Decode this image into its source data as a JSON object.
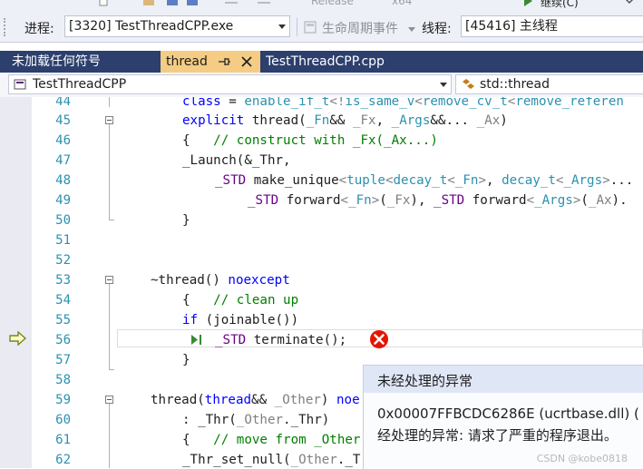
{
  "toolbar": {
    "configuration": "Release",
    "platform": "x64",
    "continue_label": "继续(C)"
  },
  "debug_location": {
    "process_label": "进程:",
    "process_value": "[3320] TestThreadCPP.exe",
    "lifecycle_label": "生命周期事件",
    "thread_label": "线程:",
    "thread_value": "[45416] 主线程"
  },
  "tabs": [
    {
      "label": "未加载任何符号"
    },
    {
      "label": "thread",
      "active": true
    },
    {
      "label": "TestThreadCPP.cpp"
    }
  ],
  "navbar": {
    "project": "TestThreadCPP",
    "scope": "std::thread"
  },
  "editor": {
    "lines": [
      {
        "num": "44",
        "text": "class = enable_if_t<!is_same_v<remove_cv_t<remove_referen"
      },
      {
        "num": "45",
        "text": "explicit thread(_Fn&& _Fx, _Args&&... _Ax)"
      },
      {
        "num": "46",
        "text": "{   // construct with _Fx(_Ax...)"
      },
      {
        "num": "47",
        "text": "_Launch(&_Thr,"
      },
      {
        "num": "48",
        "text": "_STD make_unique<tuple<decay_t<_Fn>, decay_t<_Args>..."
      },
      {
        "num": "49",
        "text": "_STD forward<_Fn>(_Fx), _STD forward<_Args>(_Ax)."
      },
      {
        "num": "50",
        "text": "}"
      },
      {
        "num": "51",
        "text": ""
      },
      {
        "num": "52",
        "text": ""
      },
      {
        "num": "53",
        "text": "~thread() noexcept"
      },
      {
        "num": "54",
        "text": "{   // clean up"
      },
      {
        "num": "55",
        "text": "if (joinable())"
      },
      {
        "num": "56",
        "text": "_STD terminate();"
      },
      {
        "num": "57",
        "text": "}"
      },
      {
        "num": "58",
        "text": ""
      },
      {
        "num": "59",
        "text": "thread(thread&& _Other) noe"
      },
      {
        "num": "60",
        "text": ": _Thr(_Other._Thr)"
      },
      {
        "num": "61",
        "text": "{   // move from _Other"
      },
      {
        "num": "62",
        "text": "_Thr_set_null(_Other._T"
      }
    ]
  },
  "exception": {
    "title": "未经处理的异常",
    "message_line1": "0x00007FFBCDC6286E (ucrtbase.dll) (",
    "message_line2": "经处理的异常: 请求了严重的程序退出。",
    "watermark": "CSDN @kobe0818"
  },
  "colors": {
    "tab_strip": "#2c3f6d",
    "active_tab": "#f5cc84",
    "keyword": "#0000ff",
    "comment": "#008000",
    "macro": "#6f008a",
    "type": "#2b91af",
    "error": "#e51400"
  }
}
